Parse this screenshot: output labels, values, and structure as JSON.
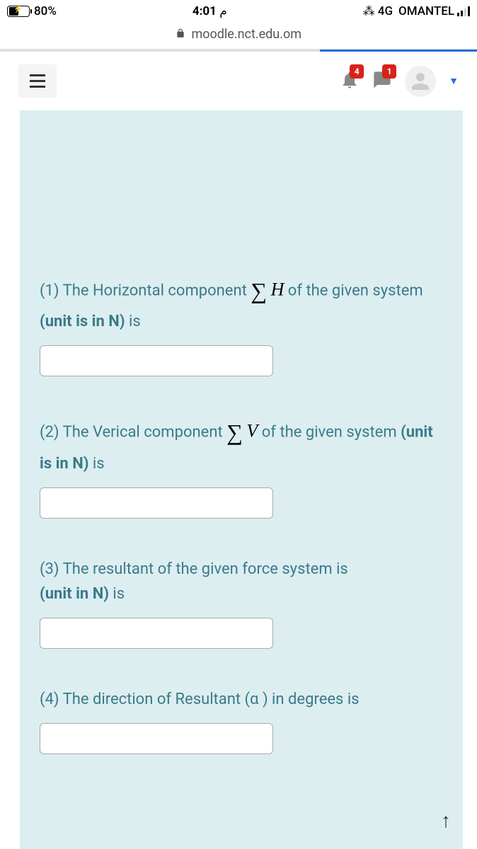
{
  "status_bar": {
    "battery_percent": "80%",
    "time_prefix": "م",
    "time": "4:01",
    "network_type": "4G",
    "carrier": "OMANTEL"
  },
  "url_bar": {
    "url": "moodle.nct.edu.om"
  },
  "header": {
    "notification_badge": "4",
    "message_badge": "1"
  },
  "questions": {
    "q1_part1": "(1) The Horizontal component ",
    "q1_sigma": "∑",
    "q1_var": "H",
    "q1_part2": " of the given system  ",
    "q1_unit": "(unit is in N)",
    "q1_part3": " is",
    "q2_part1": "(2) The Verical component ",
    "q2_sigma": "∑",
    "q2_var": "V",
    "q2_part2": " of the given system  ",
    "q2_unit": "(unit is in N)",
    "q2_part3": " is",
    "q3_part1": "(3) The resultant of the given force system is ",
    "q3_unit": "(unit in N)",
    "q3_part2": " is",
    "q4_text": "(4) The direction of Resultant (α ) in degrees is"
  }
}
